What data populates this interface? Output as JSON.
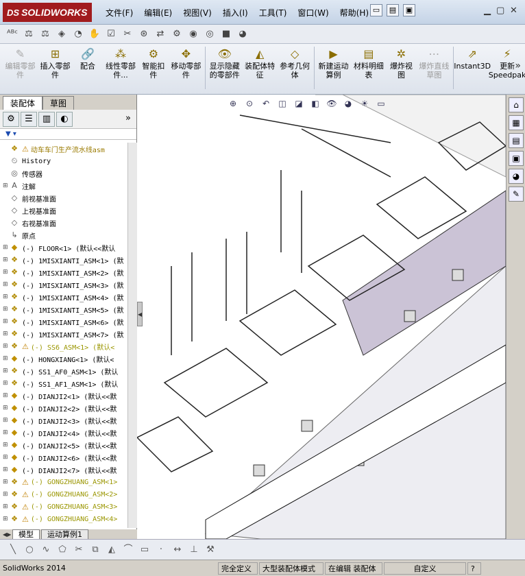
{
  "app": {
    "logo": "SOLIDWORKS",
    "logo_ds": "DS"
  },
  "menu": [
    "文件(F)",
    "编辑(E)",
    "视图(V)",
    "插入(I)",
    "工具(T)",
    "窗口(W)",
    "帮助(H)"
  ],
  "toolbar_commands": [
    {
      "label": "编辑零部件",
      "icon": "edit-component-icon",
      "disabled": true
    },
    {
      "label": "插入零部件",
      "icon": "insert-component-icon",
      "disabled": false
    },
    {
      "label": "配合",
      "icon": "mate-icon",
      "disabled": false
    },
    {
      "label": "线性零部件...",
      "icon": "linear-pattern-icon",
      "disabled": false
    },
    {
      "label": "智能扣件",
      "icon": "smart-fastener-icon",
      "disabled": false
    },
    {
      "label": "移动零部件",
      "icon": "move-component-icon",
      "disabled": false
    },
    {
      "label": "显示隐藏的零部件",
      "icon": "show-hidden-icon",
      "disabled": false
    },
    {
      "label": "装配体特征",
      "icon": "assembly-feature-icon",
      "disabled": false
    },
    {
      "label": "参考几何体",
      "icon": "reference-geometry-icon",
      "disabled": false
    },
    {
      "label": "新建运动算例",
      "icon": "motion-study-icon",
      "disabled": false
    },
    {
      "label": "材料明细表",
      "icon": "bom-icon",
      "disabled": false
    },
    {
      "label": "爆炸视图",
      "icon": "exploded-view-icon",
      "disabled": false
    },
    {
      "label": "爆炸直线草图",
      "icon": "explode-line-icon",
      "disabled": true
    },
    {
      "label": "Instant3D",
      "icon": "instant3d-icon",
      "disabled": false
    },
    {
      "label": "更新Speedpak",
      "icon": "speedpak-icon",
      "disabled": false
    }
  ],
  "command_tabs": [
    "装配体",
    "草图"
  ],
  "tree": [
    {
      "text": "动车车门生产流水线asm",
      "icon": "assembly-icon",
      "warn": true,
      "root": true
    },
    {
      "text": "History",
      "icon": "history-icon"
    },
    {
      "text": "传感器",
      "icon": "sensor-icon"
    },
    {
      "text": "注解",
      "icon": "annotation-icon",
      "exp": true
    },
    {
      "text": "前视基准面",
      "icon": "plane-icon"
    },
    {
      "text": "上视基准面",
      "icon": "plane-icon"
    },
    {
      "text": "右视基准面",
      "icon": "plane-icon"
    },
    {
      "text": "原点",
      "icon": "origin-icon"
    },
    {
      "text": "(-) FLOOR<1> (默认<<默认",
      "icon": "part-icon",
      "exp": true
    },
    {
      "text": "(-) 1MISXIANTI_ASM<1> (默",
      "icon": "assembly-icon",
      "exp": true
    },
    {
      "text": "(-) 1MISXIANTI_ASM<2> (默",
      "icon": "assembly-icon",
      "exp": true
    },
    {
      "text": "(-) 1MISXIANTI_ASM<3> (默",
      "icon": "assembly-icon",
      "exp": true
    },
    {
      "text": "(-) 1MISXIANTI_ASM<4> (默",
      "icon": "assembly-icon",
      "exp": true
    },
    {
      "text": "(-) 1MISXIANTI_ASM<5> (默",
      "icon": "assembly-icon",
      "exp": true
    },
    {
      "text": "(-) 1MISXIANTI_ASM<6> (默",
      "icon": "assembly-icon",
      "exp": true
    },
    {
      "text": "(-) 1MISXIANTI_ASM<7> (默",
      "icon": "assembly-icon",
      "exp": true
    },
    {
      "text": "(-) SS6_ASM<1> (默认<",
      "icon": "assembly-icon",
      "exp": true,
      "warn": true
    },
    {
      "text": "(-) HONGXIANG<1> (默认<",
      "icon": "part-icon",
      "exp": true
    },
    {
      "text": "(-) SS1_AF0_ASM<1> (默认",
      "icon": "assembly-icon",
      "exp": true
    },
    {
      "text": "(-) SS1_AF1_ASM<1> (默认",
      "icon": "assembly-icon",
      "exp": true
    },
    {
      "text": "(-) DIANJI2<1> (默认<<默",
      "icon": "part-icon",
      "exp": true
    },
    {
      "text": "(-) DIANJI2<2> (默认<<默",
      "icon": "part-icon",
      "exp": true
    },
    {
      "text": "(-) DIANJI2<3> (默认<<默",
      "icon": "part-icon",
      "exp": true
    },
    {
      "text": "(-) DIANJI2<4> (默认<<默",
      "icon": "part-icon",
      "exp": true
    },
    {
      "text": "(-) DIANJI2<5> (默认<<默",
      "icon": "part-icon",
      "exp": true
    },
    {
      "text": "(-) DIANJI2<6> (默认<<默",
      "icon": "part-icon",
      "exp": true
    },
    {
      "text": "(-) DIANJI2<7> (默认<<默",
      "icon": "part-icon",
      "exp": true
    },
    {
      "text": "(-) GONGZHUANG_ASM<1>",
      "icon": "assembly-icon",
      "exp": true,
      "warn": true
    },
    {
      "text": "(-) GONGZHUANG_ASM<2>",
      "icon": "assembly-icon",
      "exp": true,
      "warn": true
    },
    {
      "text": "(-) GONGZHUANG_ASM<3>",
      "icon": "assembly-icon",
      "exp": true,
      "warn": true
    },
    {
      "text": "(-) GONGZHUANG_ASM<4>",
      "icon": "assembly-icon",
      "exp": true,
      "warn": true
    }
  ],
  "bottom_tabs": [
    "模型",
    "运动算例1"
  ],
  "status": {
    "app": "SolidWorks 2014",
    "defined": "完全定义",
    "mode": "大型装配体模式",
    "editing": "在编辑 装配体",
    "units": "自定义"
  }
}
